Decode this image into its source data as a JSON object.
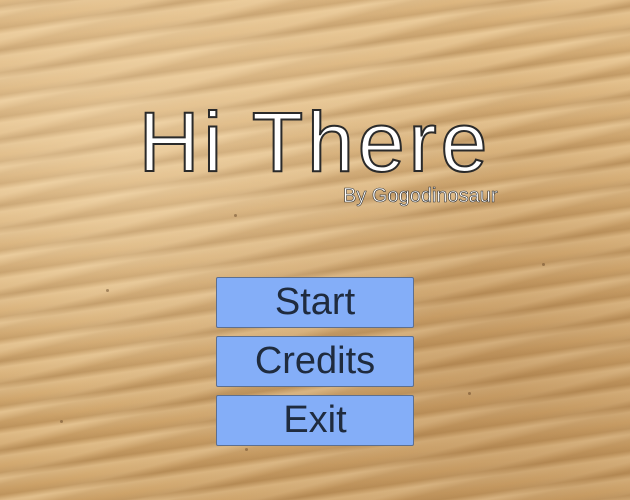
{
  "game": {
    "title": "Hi There",
    "byline": "By Gogodinosaur"
  },
  "menu": {
    "buttons": [
      {
        "label": "Start"
      },
      {
        "label": "Credits"
      },
      {
        "label": "Exit"
      }
    ]
  },
  "colors": {
    "button_fill": "#84aef8",
    "button_text": "#1f2b3e",
    "sand_base": "#d9b27a",
    "title_fill": "#ffffff"
  }
}
